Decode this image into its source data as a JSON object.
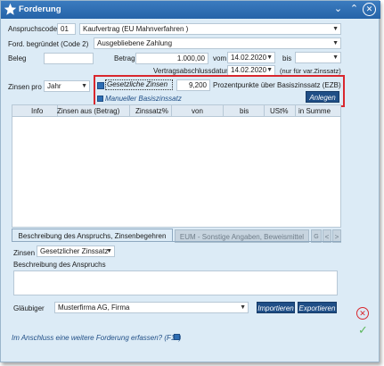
{
  "window": {
    "title": "Forderung"
  },
  "form": {
    "anspruchscode_label": "Anspruchscode",
    "anspruchscode_value": "01",
    "anspruchscode_text": "Kaufvertrag (EU Mahnverfahren )",
    "begruendet_label": "Ford. begründet (Code 2)",
    "begruendet_value": "Ausgebliebene Zahlung",
    "beleg_label": "Beleg",
    "beleg_value": "",
    "betrag_label": "Betrag",
    "betrag_value": "1.000,00",
    "vom_label": "vom",
    "vom_value": "14.02.2020",
    "bis_label": "bis",
    "bis_value": "",
    "vertragsabschluss_label": "Vertragsabschlussdatum",
    "vertragsabschluss_value": "14.02.2020",
    "vertragsabschluss_hint": "(nur für var.Zinssatz)",
    "zinsen_pro_label": "Zinsen pro",
    "zinsen_pro_value": "Jahr",
    "gesetzliche_zinsen_label": "Gesetzliche Zinsen",
    "prozent_value": "9,200",
    "prozent_label": "Prozentpunkte über Basiszinssatz (EZB)",
    "manueller_label": "Manueller Basiszinssatz",
    "anlegen_label": "Anlegen"
  },
  "table": {
    "columns": [
      "Info",
      "Zinsen aus (Betrag)",
      "Zinssatz%",
      "von",
      "bis",
      "USt%",
      "in Summe"
    ]
  },
  "tabs": [
    {
      "label": "Beschreibung des Anspruchs, Zinsenbegehren",
      "active": true
    },
    {
      "label": "EUM - Sonstige Angaben, Beweismittel",
      "active": false
    }
  ],
  "tab_nav": {
    "prev": "<",
    "next": ">"
  },
  "description": {
    "zinsen_label": "Zinsen",
    "zinsen_value": "Gesetzlicher Zinssatz",
    "beschreibung_label": "Beschreibung des Anspruchs",
    "beschreibung_value": ""
  },
  "glaeubiger": {
    "label": "Gläubiger",
    "value": "Musterfirma AG, Firma",
    "import_label": "Importieren",
    "export_label": "Exportieren"
  },
  "footer": {
    "weitere_label": "Im Anschluss eine weitere Forderung erfassen? (F10)"
  },
  "icons": {
    "title_star": "star-icon",
    "minimize": "chevron-down-icon",
    "maximize": "chevron-up-icon",
    "close": "close-icon",
    "cancel": "cancel-circle-icon",
    "confirm": "checkmark-icon"
  },
  "colors": {
    "titlebar": "#2f6eb3",
    "frame": "#dcebf6",
    "highlight": "#d9272e",
    "button": "#1f4e86",
    "cancel": "#d9272e",
    "confirm": "#5cb85c"
  }
}
